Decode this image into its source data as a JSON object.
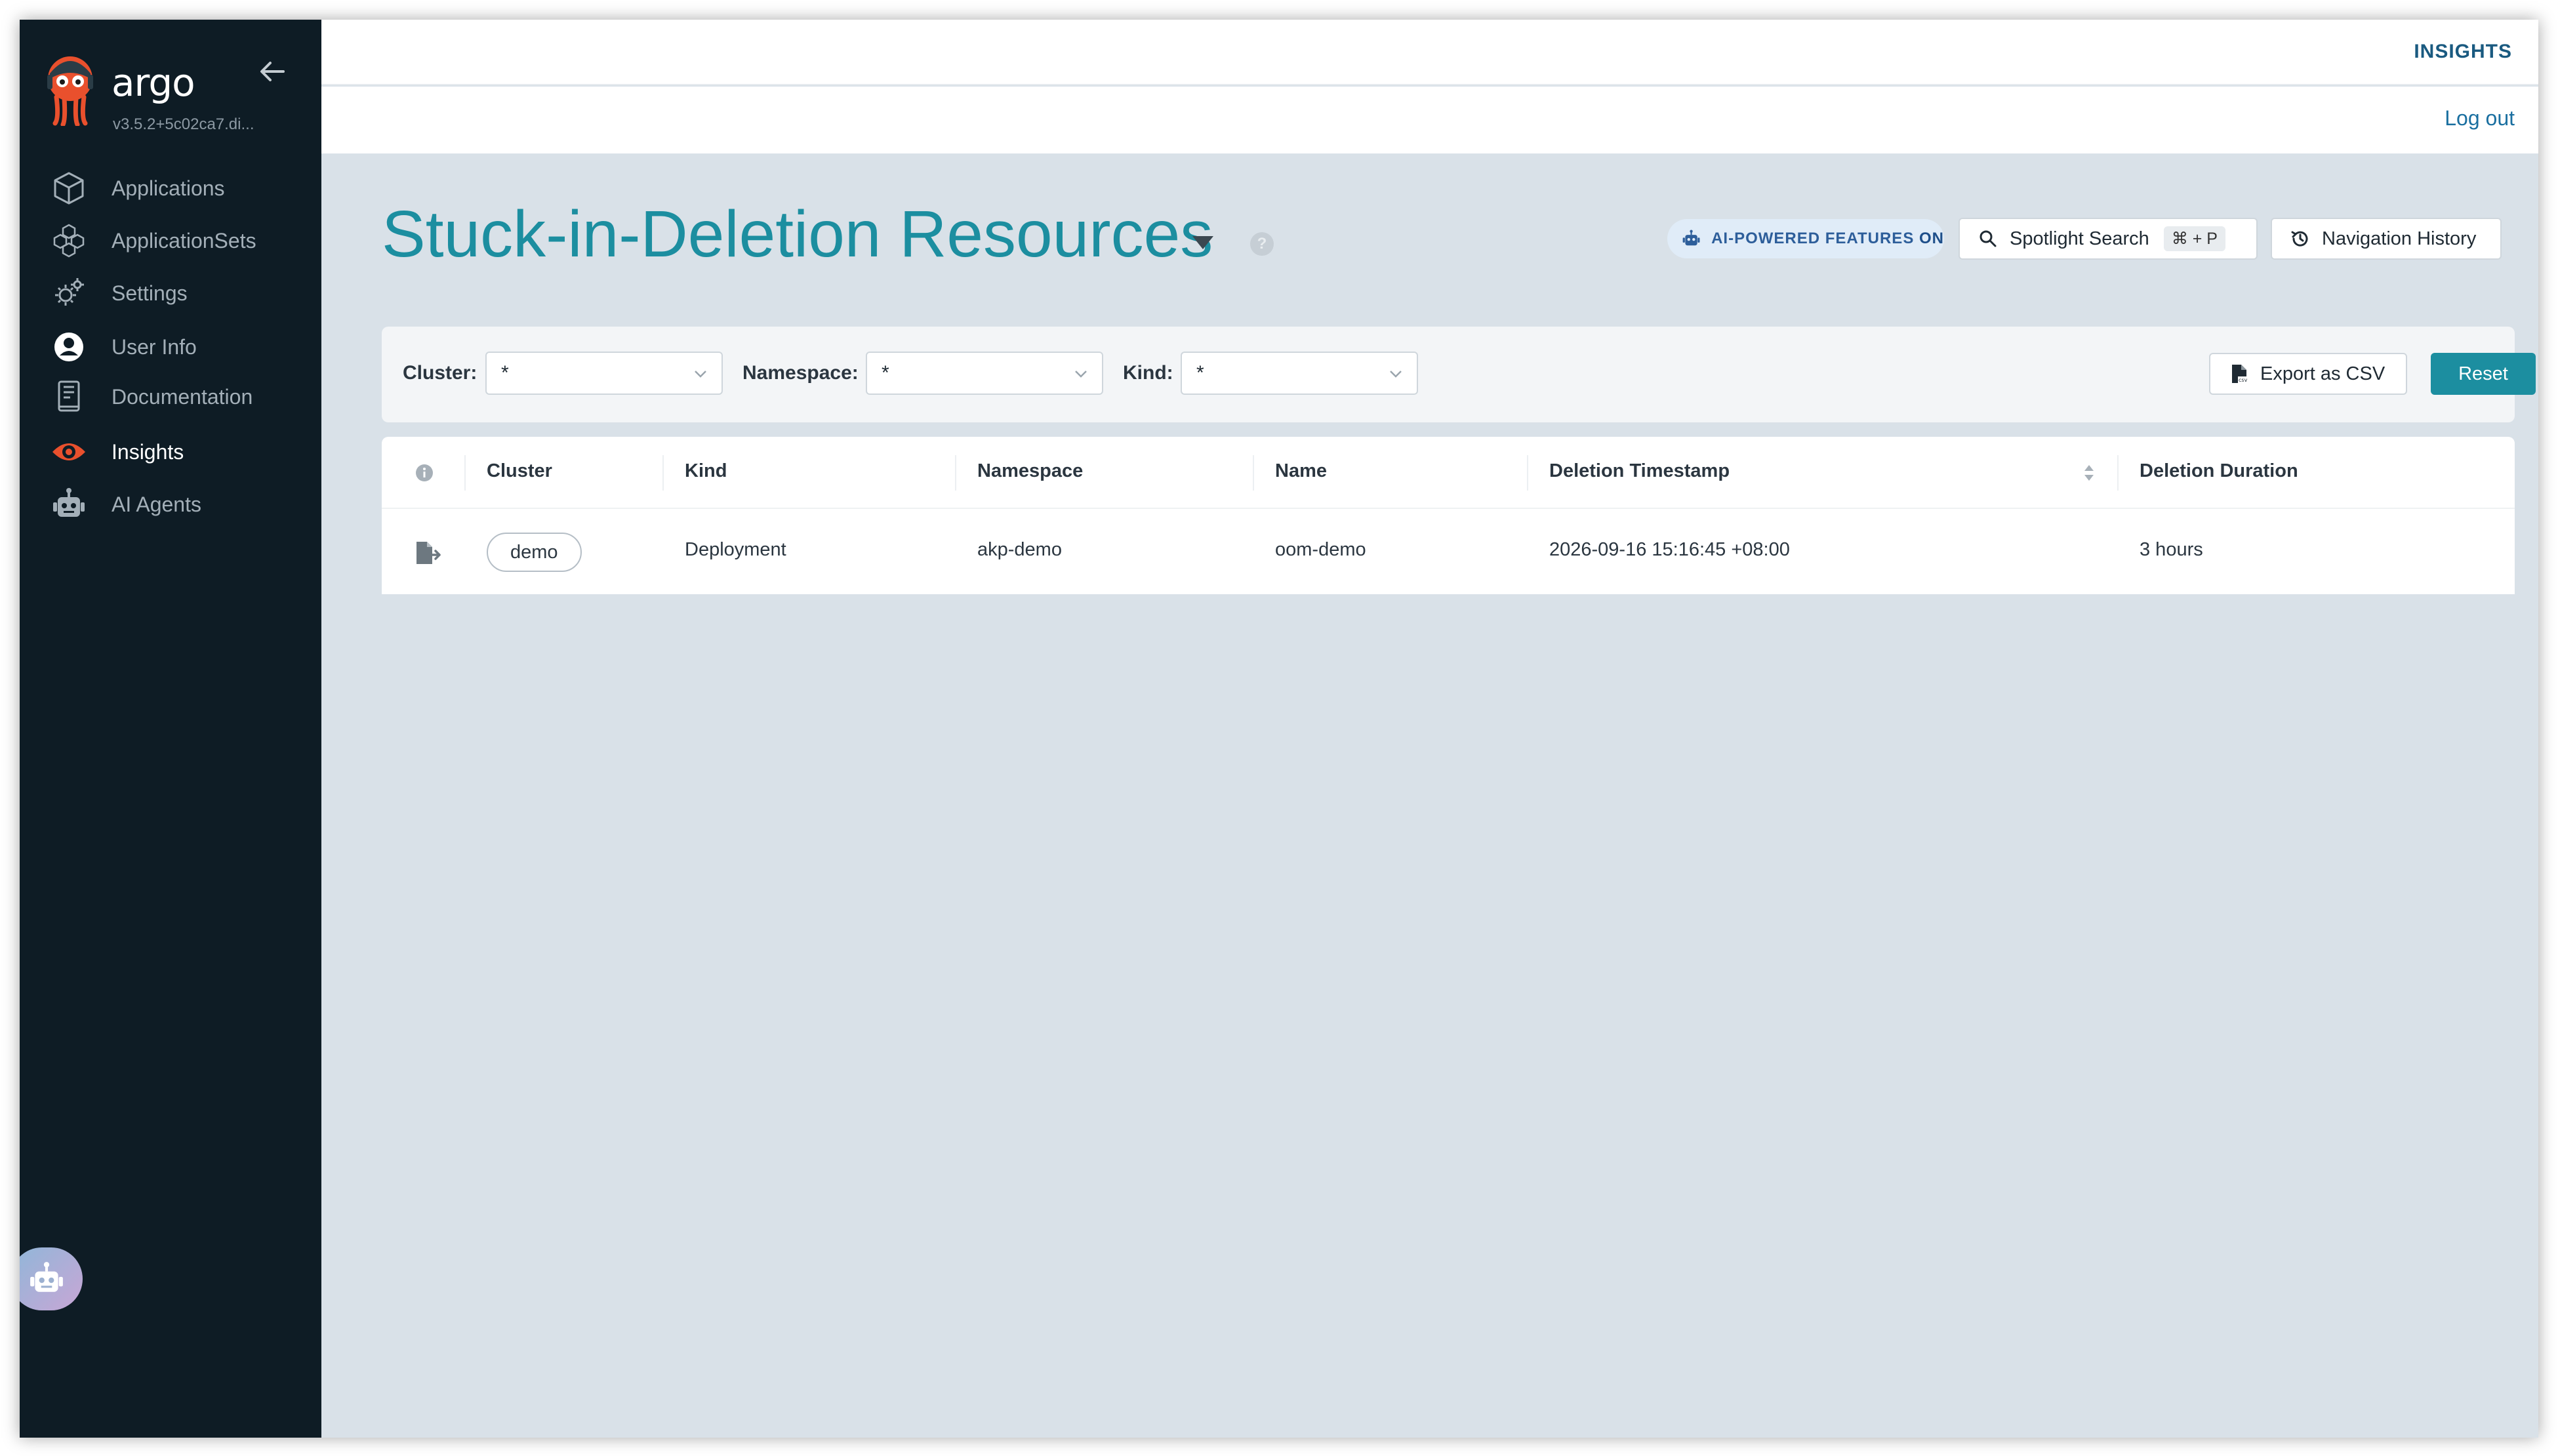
{
  "app": {
    "brand": "argo",
    "version": "v3.5.2+5c02ca7.di..."
  },
  "sidebar": {
    "items": [
      {
        "label": "Applications",
        "icon": "cube-icon"
      },
      {
        "label": "ApplicationSets",
        "icon": "cubes-icon"
      },
      {
        "label": "Settings",
        "icon": "gears-icon"
      },
      {
        "label": "User Info",
        "icon": "user-circle-icon"
      },
      {
        "label": "Documentation",
        "icon": "book-icon"
      },
      {
        "label": "Insights",
        "icon": "eye-icon",
        "active": true
      },
      {
        "label": "AI Agents",
        "icon": "robot-icon"
      }
    ]
  },
  "topbar": {
    "breadcrumb": "INSIGHTS",
    "logout": "Log out"
  },
  "page": {
    "title": "Stuck-in-Deletion Resources",
    "help": "?",
    "ai_badge_prefix": "AI-POWERED FEATURES",
    "ai_badge_state": "ON",
    "spotlight_label": "Spotlight Search",
    "spotlight_shortcut": "⌘ + P",
    "nav_history_label": "Navigation History"
  },
  "filters": {
    "cluster_label": "Cluster:",
    "cluster_value": "*",
    "namespace_label": "Namespace:",
    "namespace_value": "*",
    "kind_label": "Kind:",
    "kind_value": "*",
    "export_label": "Export as CSV",
    "reset_label": "Reset"
  },
  "table": {
    "columns": [
      "Cluster",
      "Kind",
      "Namespace",
      "Name",
      "Deletion Timestamp",
      "Deletion Duration"
    ],
    "rows": [
      {
        "cluster": "demo",
        "kind": "Deployment",
        "namespace": "akp-demo",
        "name": "oom-demo",
        "deletion_timestamp": "2026-09-16 15:16:45 +08:00",
        "deletion_duration": "3 hours"
      }
    ]
  },
  "colors": {
    "sidebar_bg": "#0e1c25",
    "accent": "#1c8ea0",
    "page_bg": "#d9e1e8",
    "insights_icon": "#e9502d"
  }
}
